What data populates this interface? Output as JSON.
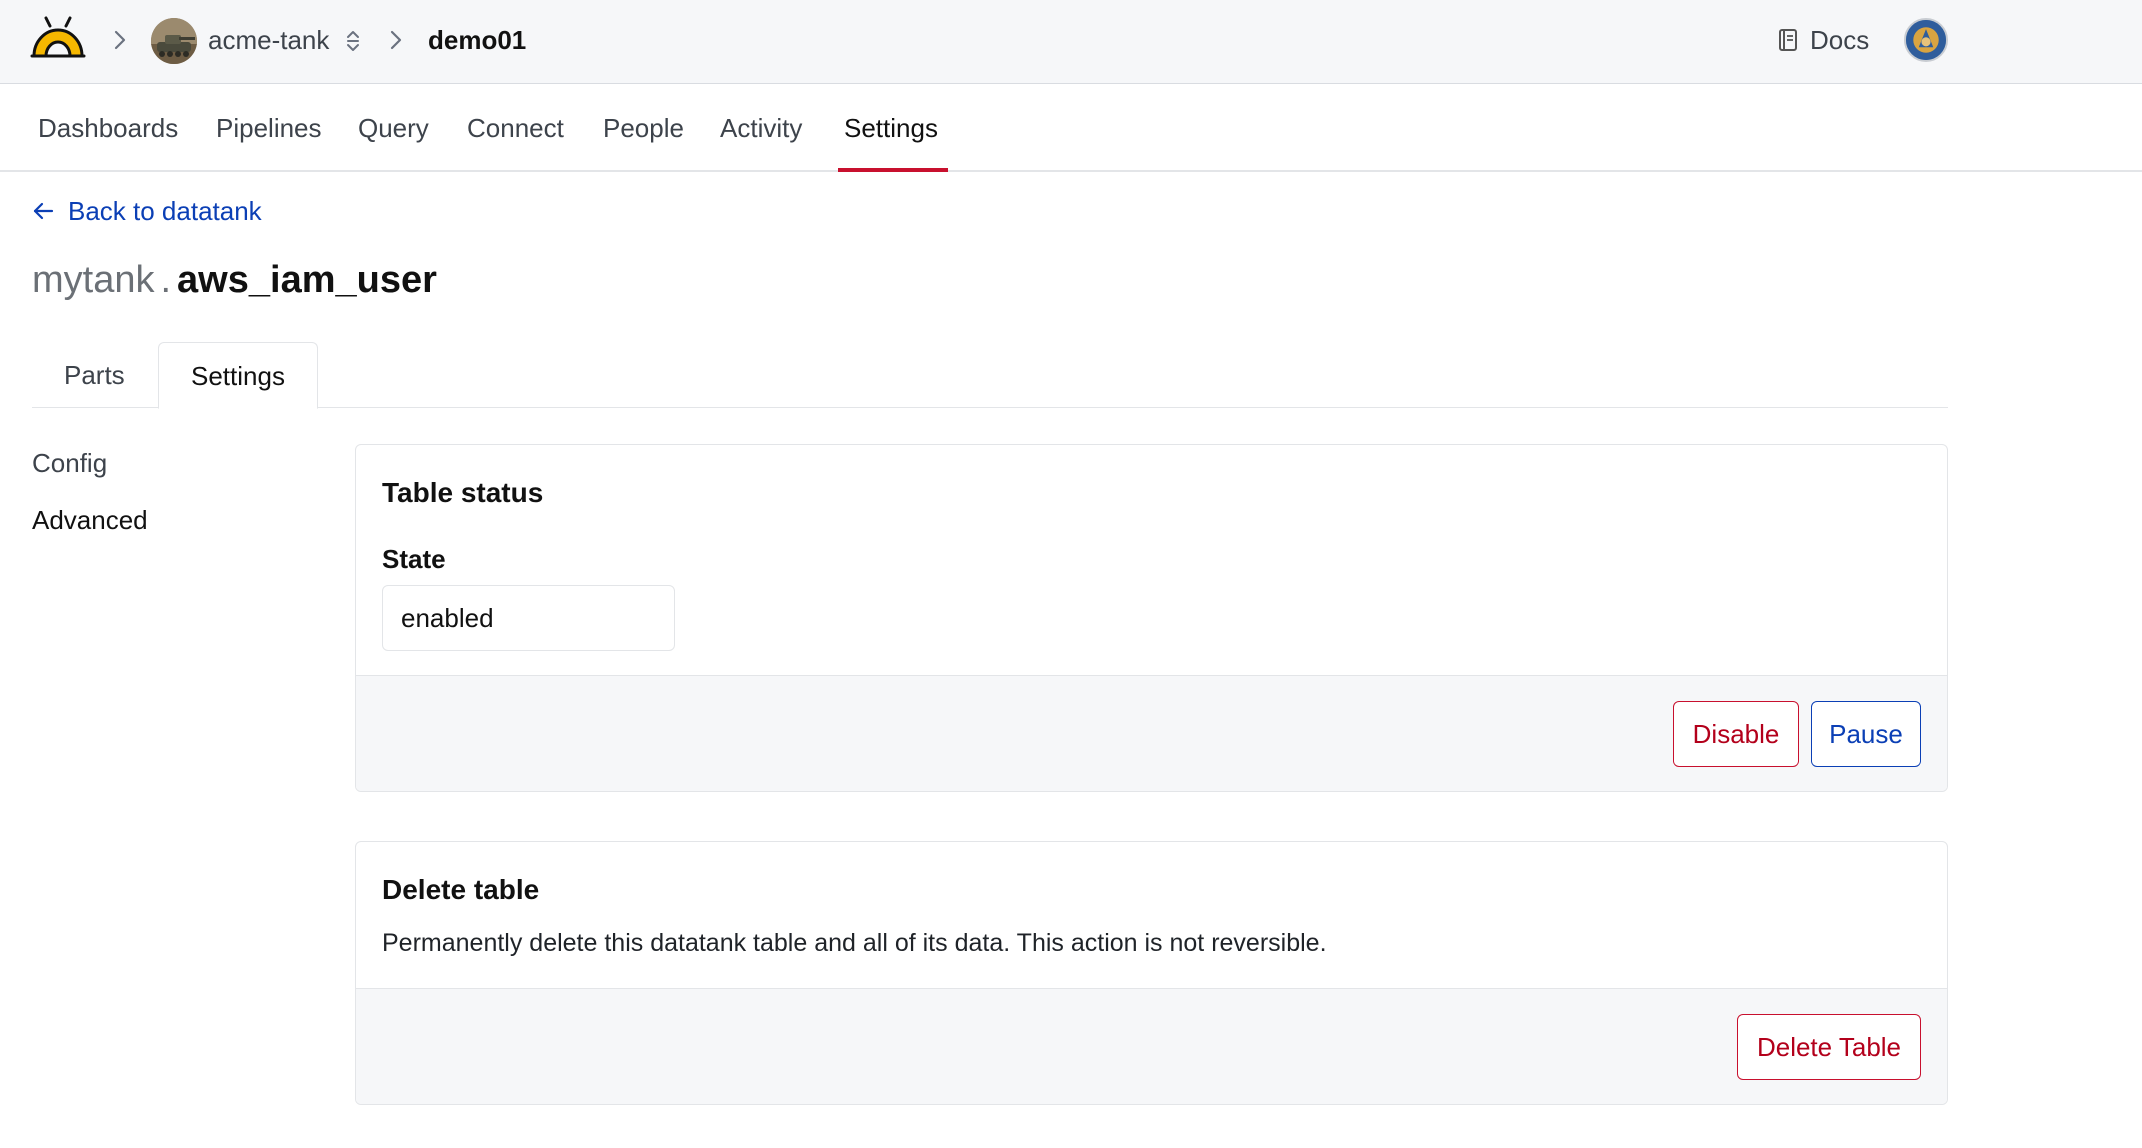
{
  "header": {
    "org_name": "acme-tank",
    "workspace_name": "demo01",
    "docs_label": "Docs"
  },
  "nav": {
    "items": [
      "Dashboards",
      "Pipelines",
      "Query",
      "Connect",
      "People",
      "Activity",
      "Settings"
    ],
    "active": "Settings"
  },
  "back_link": "Back to datatank",
  "title": {
    "schema": "mytank",
    "separator": ".",
    "table": "aws_iam_user"
  },
  "tabs": {
    "items": [
      "Parts",
      "Settings"
    ],
    "active": "Settings"
  },
  "sidebar": {
    "items": [
      "Config",
      "Advanced"
    ],
    "active": "Advanced"
  },
  "table_status": {
    "heading": "Table status",
    "state_label": "State",
    "state_value": "enabled",
    "disable_label": "Disable",
    "pause_label": "Pause"
  },
  "delete_table": {
    "heading": "Delete table",
    "description": "Permanently delete this datatank table and all of its data. This action is not reversible.",
    "button_label": "Delete Table"
  },
  "colors": {
    "accent_red": "#c8102e",
    "link_blue": "#0b3fb5",
    "logo_yellow": "#f5b700"
  },
  "icons": [
    "logo-icon",
    "chevron-right-icon",
    "sort-toggle-icon",
    "book-icon",
    "arrow-left-icon"
  ]
}
